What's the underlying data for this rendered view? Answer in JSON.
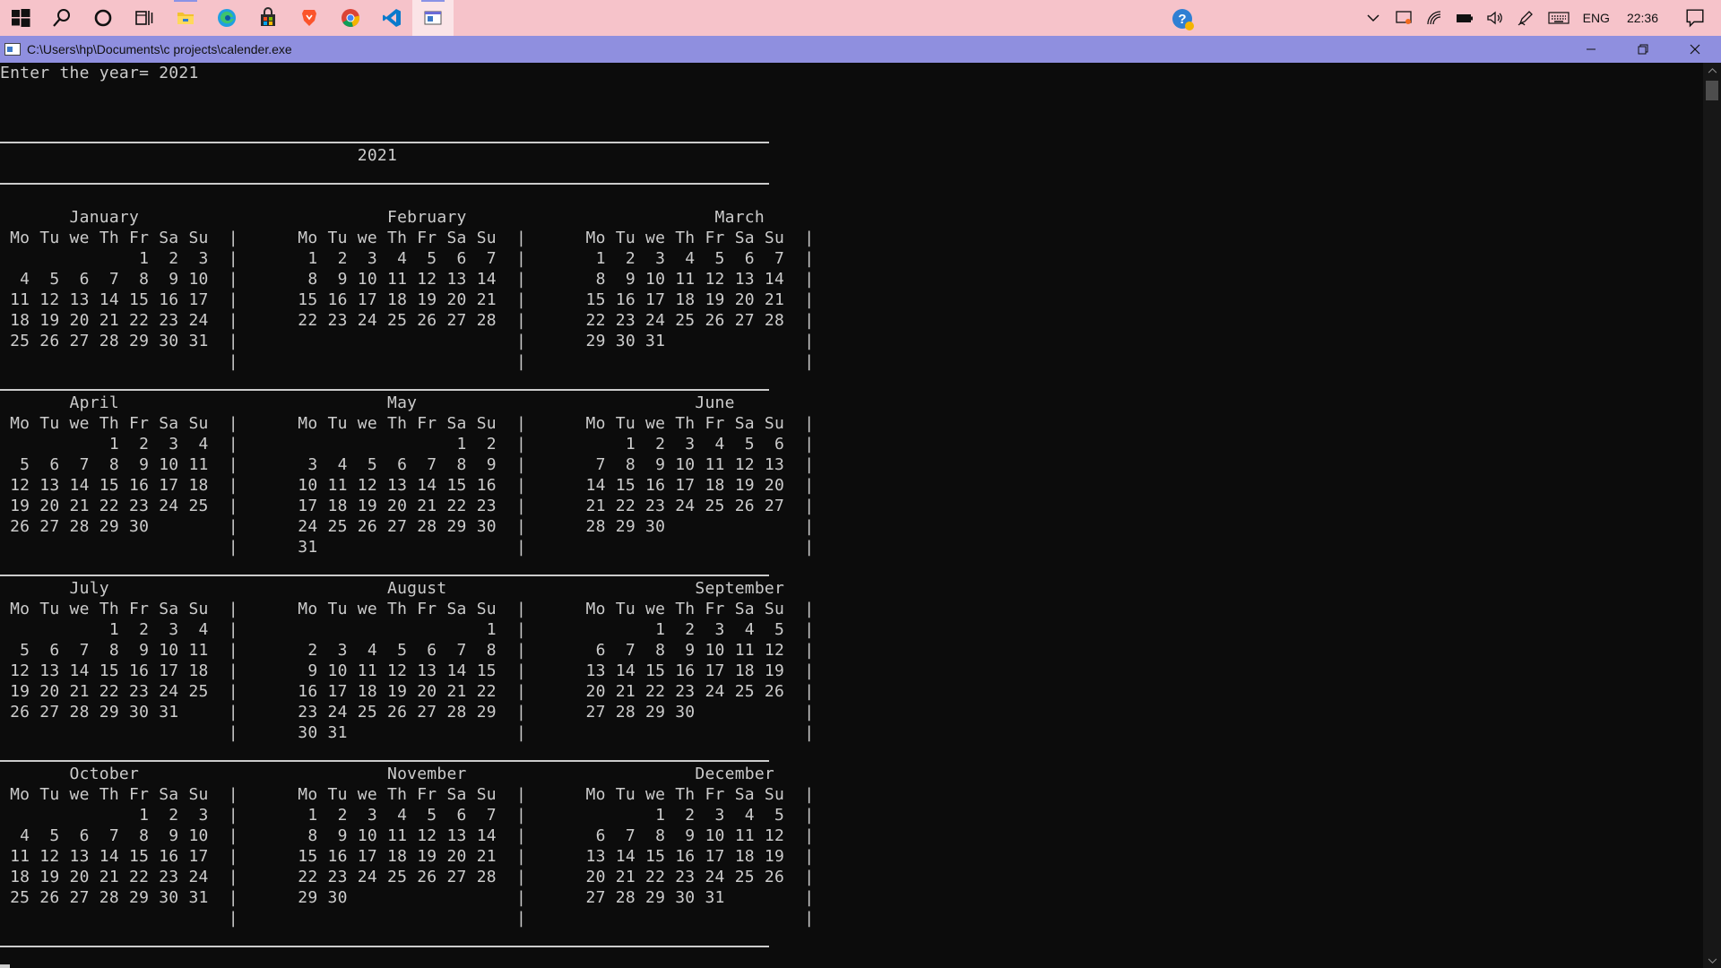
{
  "taskbar": {
    "apps": [
      {
        "name": "start",
        "icon": "windows-logo-icon"
      },
      {
        "name": "search",
        "icon": "search-icon"
      },
      {
        "name": "cortana",
        "icon": "cortana-circle-icon"
      },
      {
        "name": "task-view",
        "icon": "task-view-icon"
      },
      {
        "name": "file-explorer",
        "icon": "folder-icon"
      },
      {
        "name": "edge",
        "icon": "edge-icon"
      },
      {
        "name": "store",
        "icon": "store-bag-icon"
      },
      {
        "name": "brave",
        "icon": "brave-icon"
      },
      {
        "name": "chrome",
        "icon": "chrome-icon"
      },
      {
        "name": "vscode",
        "icon": "vscode-icon"
      },
      {
        "name": "console",
        "icon": "console-window-icon"
      }
    ],
    "tray": {
      "language": "ENG",
      "time": "22:36"
    },
    "colors": {
      "background": "#f6c3ca"
    }
  },
  "window": {
    "title": "C:\\Users\\hp\\Documents\\c projects\\calender.exe",
    "colors": {
      "titlebar": "#8f8fdf",
      "console_bg": "#0c0c0c",
      "console_fg": "#cccccc"
    }
  },
  "console": {
    "lines": [
      "Enter the year= 2021",
      "",
      "",
      "",
      "                                    2021",
      "",
      "",
      "       January                         February                         March",
      " Mo Tu we Th Fr Sa Su  |      Mo Tu we Th Fr Sa Su  |      Mo Tu we Th Fr Sa Su  |",
      "              1  2  3  |       1  2  3  4  5  6  7  |       1  2  3  4  5  6  7  |",
      "  4  5  6  7  8  9 10  |       8  9 10 11 12 13 14  |       8  9 10 11 12 13 14  |",
      " 11 12 13 14 15 16 17  |      15 16 17 18 19 20 21  |      15 16 17 18 19 20 21  |",
      " 18 19 20 21 22 23 24  |      22 23 24 25 26 27 28  |      22 23 24 25 26 27 28  |",
      " 25 26 27 28 29 30 31  |                            |      29 30 31              |",
      "                       |                            |                            |",
      "",
      "       April                           May                            June",
      " Mo Tu we Th Fr Sa Su  |      Mo Tu we Th Fr Sa Su  |      Mo Tu we Th Fr Sa Su  |",
      "           1  2  3  4  |                      1  2  |          1  2  3  4  5  6  |",
      "  5  6  7  8  9 10 11  |       3  4  5  6  7  8  9  |       7  8  9 10 11 12 13  |",
      " 12 13 14 15 16 17 18  |      10 11 12 13 14 15 16  |      14 15 16 17 18 19 20  |",
      " 19 20 21 22 23 24 25  |      17 18 19 20 21 22 23  |      21 22 23 24 25 26 27  |",
      " 26 27 28 29 30        |      24 25 26 27 28 29 30  |      28 29 30              |",
      "                       |      31                    |                            |",
      "",
      "       July                            August                         September",
      " Mo Tu we Th Fr Sa Su  |      Mo Tu we Th Fr Sa Su  |      Mo Tu we Th Fr Sa Su  |",
      "           1  2  3  4  |                         1  |             1  2  3  4  5  |",
      "  5  6  7  8  9 10 11  |       2  3  4  5  6  7  8  |       6  7  8  9 10 11 12  |",
      " 12 13 14 15 16 17 18  |       9 10 11 12 13 14 15  |      13 14 15 16 17 18 19  |",
      " 19 20 21 22 23 24 25  |      16 17 18 19 20 21 22  |      20 21 22 23 24 25 26  |",
      " 26 27 28 29 30 31     |      23 24 25 26 27 28 29  |      27 28 29 30           |",
      "                       |      30 31                 |                            |",
      "",
      "       October                         November                       December",
      " Mo Tu we Th Fr Sa Su  |      Mo Tu we Th Fr Sa Su  |      Mo Tu we Th Fr Sa Su  |",
      "              1  2  3  |       1  2  3  4  5  6  7  |             1  2  3  4  5  |",
      "  4  5  6  7  8  9 10  |       8  9 10 11 12 13 14  |       6  7  8  9 10 11 12  |",
      " 11 12 13 14 15 16 17  |      15 16 17 18 19 20 21  |      13 14 15 16 17 18 19  |",
      " 18 19 20 21 22 23 24  |      22 23 24 25 26 27 28  |      20 21 22 23 24 25 26  |",
      " 25 26 27 28 29 30 31  |      29 30                 |      27 28 29 30 31        |",
      "                       |                            |                            |"
    ]
  }
}
